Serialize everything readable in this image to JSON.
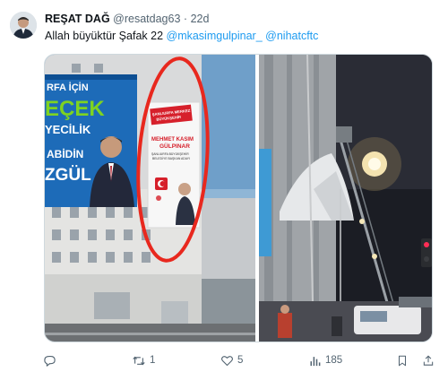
{
  "tweet": {
    "author_name": "REŞAT DAĞ",
    "author_handle": "@resatdag63",
    "separator": "·",
    "time": "22d",
    "text_prefix": "Allah büyüktür Şafak 22 ",
    "mention_1": "@mkasimgulpinar_",
    "mention_2": "@nihatcftc"
  },
  "media": {
    "left_photo": {
      "billboard_lines": [
        "RFA İÇİN",
        "EÇEK",
        "YECİLİK",
        "ABİDİN",
        "ZGÜL"
      ],
      "banner_line_1": "ŞANLIURFA MERKEZ",
      "banner_line_2": "BÜYÜKŞEHİR",
      "banner_name_1": "MEHMET KASIM",
      "banner_name_2": "GÜLPINAR",
      "banner_sub_1": "ŞANLIURFA BÜYÜKŞEHİR",
      "banner_sub_2": "BELEDİYE BAŞKAN ADAYI"
    },
    "colors": {
      "highlight_circle": "#e8281e",
      "party_red": "#d6202b",
      "billboard_blue": "#1d6bb8"
    }
  },
  "actions": {
    "reply": {
      "icon": "reply-icon",
      "count": ""
    },
    "retweet": {
      "icon": "retweet-icon",
      "count": "1"
    },
    "like": {
      "icon": "heart-icon",
      "count": "5"
    },
    "views": {
      "icon": "views-icon",
      "count": "185"
    },
    "bookmark": {
      "icon": "bookmark-icon",
      "count": ""
    },
    "share": {
      "icon": "share-icon",
      "count": ""
    }
  }
}
